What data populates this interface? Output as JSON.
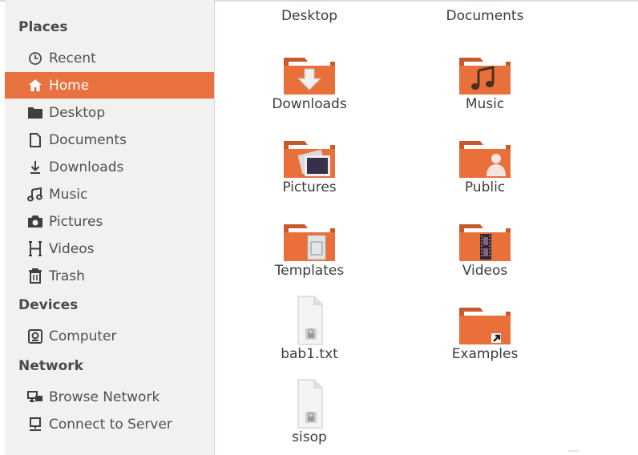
{
  "sidebar": {
    "places_title": "Places",
    "places": [
      {
        "label": "Recent",
        "icon": "clock-icon"
      },
      {
        "label": "Home",
        "icon": "home-icon",
        "selected": true
      },
      {
        "label": "Desktop",
        "icon": "desktop-folder-icon"
      },
      {
        "label": "Documents",
        "icon": "document-icon"
      },
      {
        "label": "Downloads",
        "icon": "download-arrow-icon"
      },
      {
        "label": "Music",
        "icon": "music-note-icon"
      },
      {
        "label": "Pictures",
        "icon": "camera-icon"
      },
      {
        "label": "Videos",
        "icon": "film-icon"
      },
      {
        "label": "Trash",
        "icon": "trash-icon"
      }
    ],
    "devices_title": "Devices",
    "devices": [
      {
        "label": "Computer",
        "icon": "computer-drive-icon"
      }
    ],
    "network_title": "Network",
    "network": [
      {
        "label": "Browse Network",
        "icon": "network-icon"
      },
      {
        "label": "Connect to Server",
        "icon": "server-icon"
      }
    ]
  },
  "files": [
    {
      "name": "Desktop",
      "type": "folder",
      "emblem": "desktop"
    },
    {
      "name": "Documents",
      "type": "folder",
      "emblem": "documents"
    },
    {
      "name": "Downloads",
      "type": "folder",
      "emblem": "download"
    },
    {
      "name": "Music",
      "type": "folder",
      "emblem": "music"
    },
    {
      "name": "Pictures",
      "type": "folder",
      "emblem": "pictures"
    },
    {
      "name": "Public",
      "type": "folder",
      "emblem": "public"
    },
    {
      "name": "Templates",
      "type": "folder",
      "emblem": "templates"
    },
    {
      "name": "Videos",
      "type": "folder",
      "emblem": "videos"
    },
    {
      "name": "bab1.txt",
      "type": "text-file-locked"
    },
    {
      "name": "Examples",
      "type": "folder",
      "emblem": "link"
    },
    {
      "name": "sisop",
      "type": "text-file-locked"
    }
  ],
  "colors": {
    "accent": "#e8713f",
    "folder_orange": "#e9703b",
    "sidebar_bg": "#f2f1f0"
  }
}
